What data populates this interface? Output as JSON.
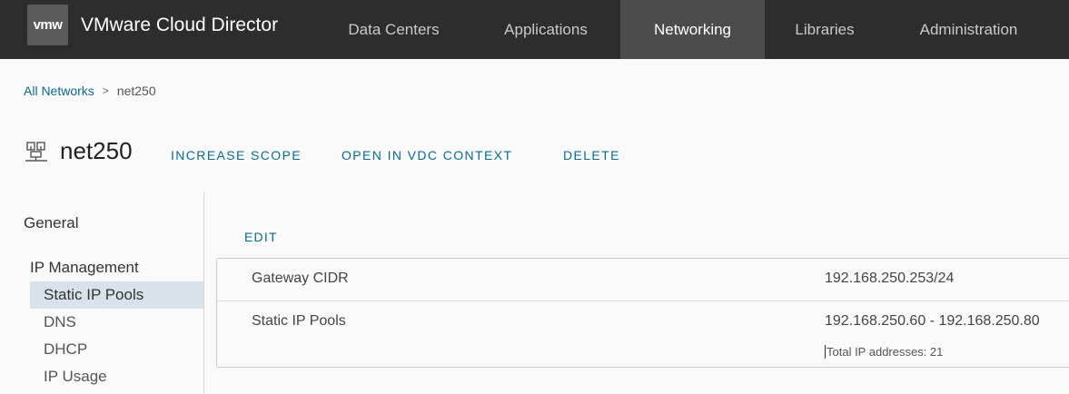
{
  "header": {
    "logo_text": "vmw",
    "app_title": "VMware Cloud Director",
    "nav": [
      {
        "label": "Data Centers"
      },
      {
        "label": "Applications"
      },
      {
        "label": "Networking"
      },
      {
        "label": "Libraries"
      },
      {
        "label": "Administration"
      }
    ],
    "active_nav": "Networking"
  },
  "breadcrumb": {
    "parent": "All Networks",
    "separator": ">",
    "current": "net250"
  },
  "page": {
    "title": "net250",
    "icon": "network-icon",
    "actions": {
      "increase_scope": "INCREASE SCOPE",
      "open_in_vdc": "OPEN IN VDC CONTEXT",
      "delete": "DELETE"
    }
  },
  "sidebar": {
    "general": "General",
    "group": "IP Management",
    "items": [
      {
        "label": "Static IP Pools"
      },
      {
        "label": "DNS"
      },
      {
        "label": "DHCP"
      },
      {
        "label": "IP Usage"
      }
    ],
    "active_item": "Static IP Pools"
  },
  "content": {
    "edit_label": "EDIT",
    "rows": [
      {
        "label": "Gateway CIDR",
        "value": "192.168.250.253/24"
      },
      {
        "label": "Static IP Pools",
        "value": "192.168.250.60 - 192.168.250.80"
      }
    ],
    "total_ip_text": "Total IP addresses: 21"
  },
  "colors": {
    "header_bg": "#2d2d2d",
    "active_nav_bg": "#4c4c4c",
    "link": "#0a6a93",
    "sidebar_active_bg": "#d8e3e9"
  }
}
